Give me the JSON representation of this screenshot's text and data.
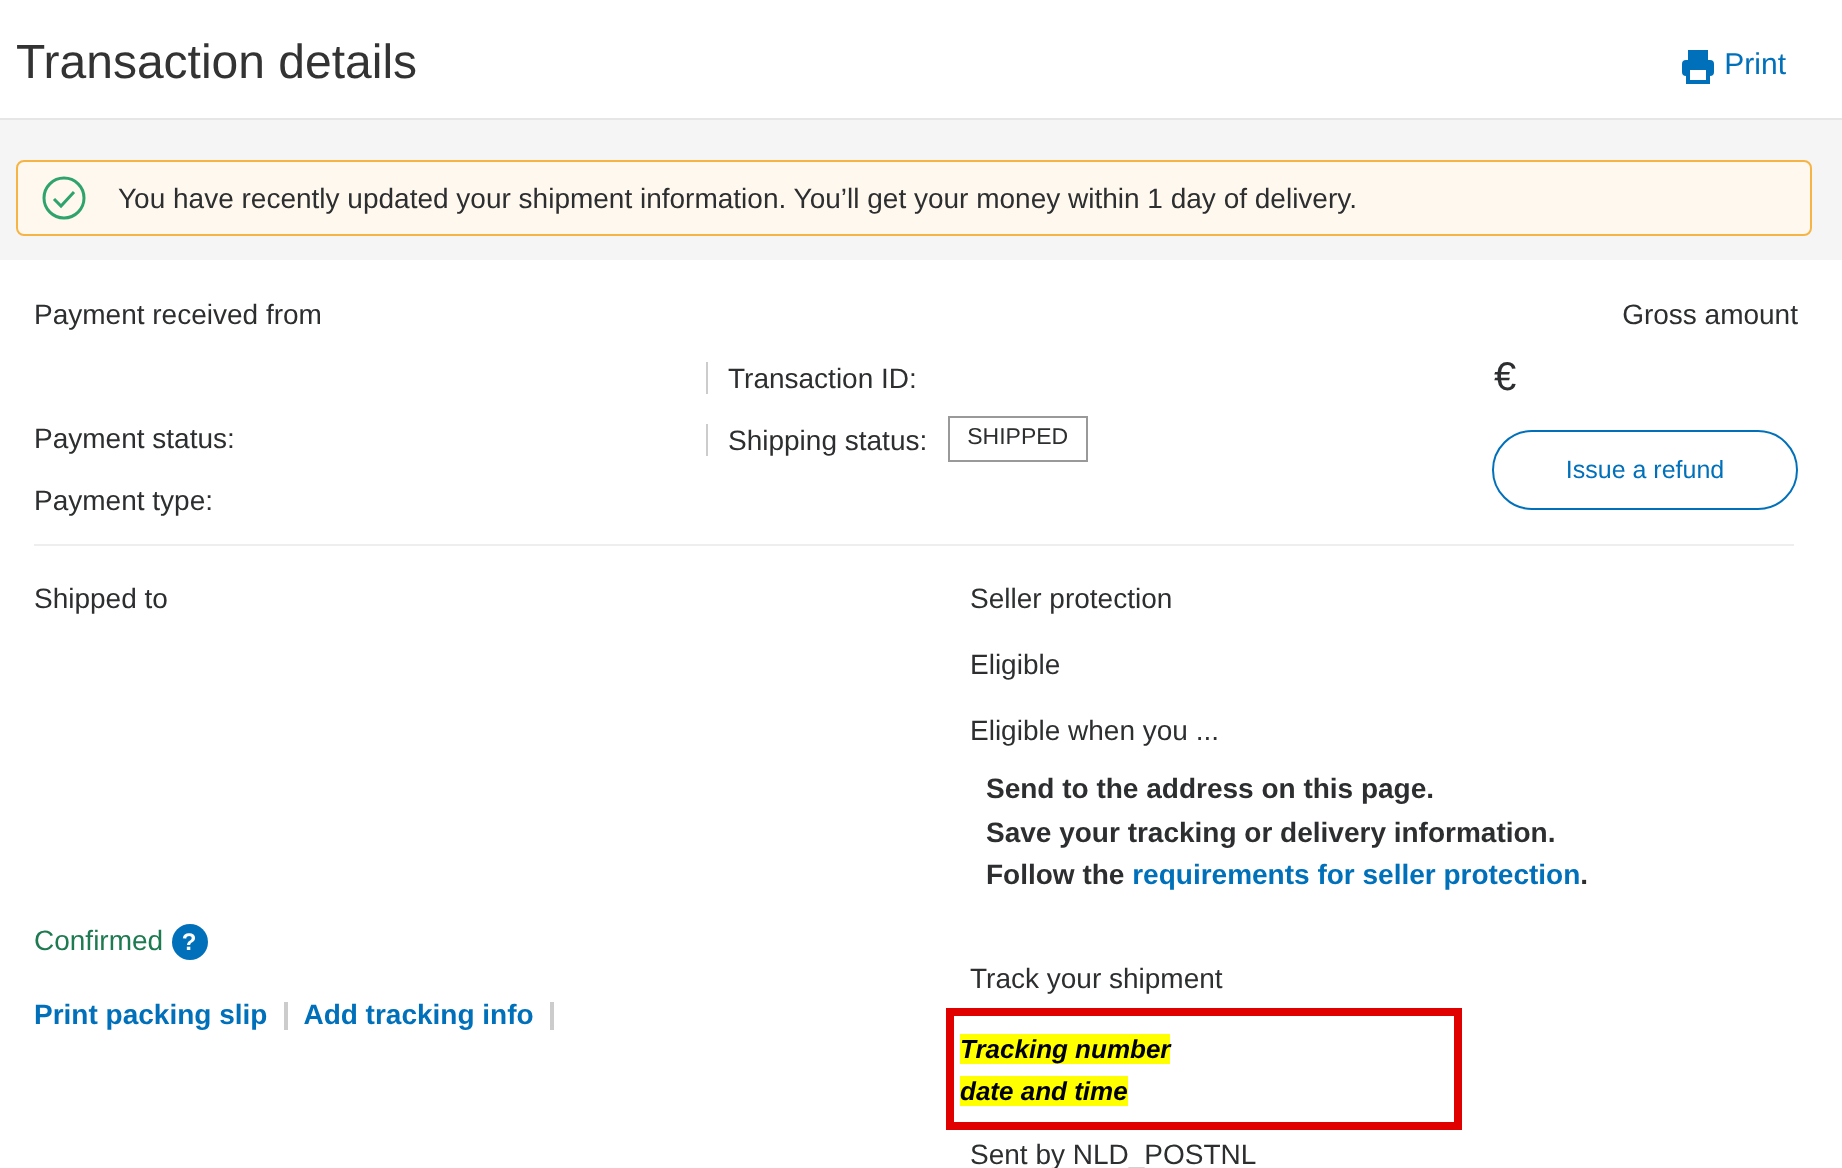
{
  "header": {
    "title": "Transaction details",
    "print_link": "Print"
  },
  "alert": {
    "message": "You have recently updated your shipment information. You’ll get your money within 1 day of delivery."
  },
  "summary": {
    "payment_received_from": "Payment received from",
    "gross_amount": "Gross amount",
    "transaction_id": "Transaction ID:",
    "currency": "€",
    "payment_status": "Payment status:",
    "shipping_status": "Shipping status:",
    "shipping_status_badge": "SHIPPED",
    "refund_button": "Issue a refund",
    "payment_type": "Payment type:"
  },
  "shipping": {
    "title": "Shipped to",
    "address_status": "Confirmed",
    "help_icon_text": "?",
    "links": [
      "Print packing slip",
      "Add tracking info"
    ]
  },
  "seller_protection": {
    "title": "Seller protection",
    "status": "Eligible",
    "intro": "Eligible when you ...",
    "requirements": [
      {
        "text": "Send to the address on this page."
      },
      {
        "text": "Save your tracking or delivery information."
      },
      {
        "text": "Follow the ",
        "link": "requirements for seller protection",
        "suffix": "."
      }
    ]
  },
  "tracking": {
    "title": "Track your shipment",
    "highlighted_lines": [
      "Tracking number",
      "date and time"
    ],
    "sent_by": "Sent by NLD_POSTNL"
  }
}
